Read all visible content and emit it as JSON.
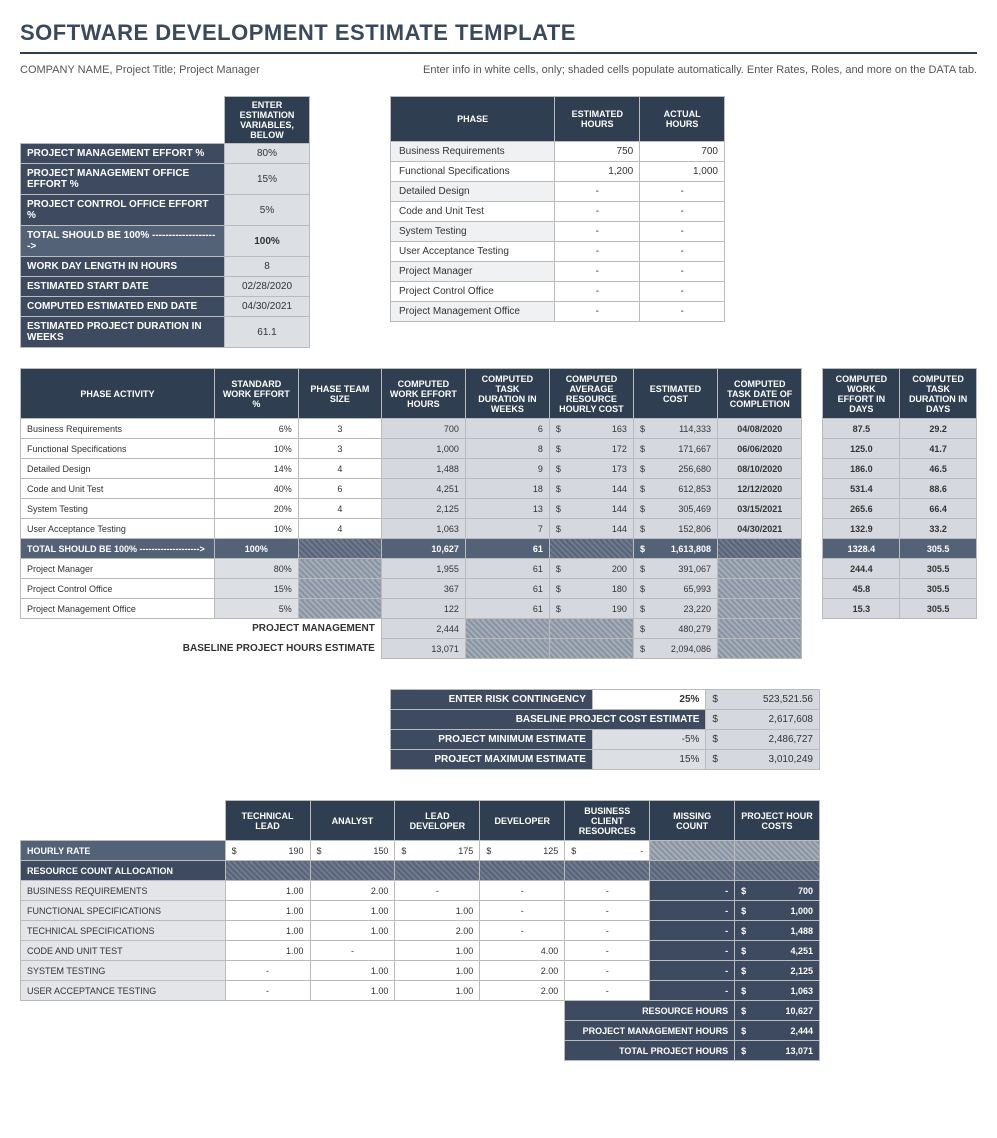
{
  "title": "SOFTWARE DEVELOPMENT ESTIMATE TEMPLATE",
  "company_line": "COMPANY NAME, Project Title; Project Manager",
  "instruction": "Enter info in white cells, only; shaded cells populate automatically.  Enter Rates, Roles, and more on the DATA tab.",
  "vars": {
    "header": "ENTER ESTIMATION VARIABLES, BELOW",
    "rows": [
      {
        "label": "PROJECT MANAGEMENT EFFORT %",
        "val": "80%"
      },
      {
        "label": "PROJECT MANAGEMENT OFFICE EFFORT %",
        "val": "15%"
      },
      {
        "label": "PROJECT CONTROL OFFICE EFFORT %",
        "val": "5%"
      }
    ],
    "total_label": "TOTAL SHOULD BE 100% -------------------->",
    "total_val": "100%",
    "rows2": [
      {
        "label": "WORK DAY LENGTH IN HOURS",
        "val": "8"
      },
      {
        "label": "ESTIMATED START DATE",
        "val": "02/28/2020"
      },
      {
        "label": "COMPUTED ESTIMATED END DATE",
        "val": "04/30/2021"
      },
      {
        "label": "ESTIMATED PROJECT DURATION IN WEEKS",
        "val": "61.1"
      }
    ]
  },
  "phases": {
    "h_phase": "PHASE",
    "h_est": "ESTIMATED HOURS",
    "h_act": "ACTUAL HOURS",
    "rows": [
      {
        "name": "Business Requirements",
        "est": "750",
        "act": "700"
      },
      {
        "name": "Functional Specifications",
        "est": "1,200",
        "act": "1,000"
      },
      {
        "name": "Detailed Design",
        "est": "-",
        "act": "-"
      },
      {
        "name": "Code and Unit Test",
        "est": "-",
        "act": "-"
      },
      {
        "name": "System Testing",
        "est": "-",
        "act": "-"
      },
      {
        "name": "User Acceptance Testing",
        "est": "-",
        "act": "-"
      },
      {
        "name": "Project Manager",
        "est": "-",
        "act": "-"
      },
      {
        "name": "Project Control Office",
        "est": "-",
        "act": "-"
      },
      {
        "name": "Project Management Office",
        "est": "-",
        "act": "-"
      }
    ]
  },
  "main": {
    "h": [
      "PHASE ACTIVITY",
      "STANDARD WORK EFFORT %",
      "PHASE TEAM SIZE",
      "COMPUTED WORK EFFORT HOURS",
      "COMPUTED TASK DURATION IN WEEKS",
      "COMPUTED AVERAGE RESOURCE HOURLY COST",
      "ESTIMATED COST",
      "COMPUTED TASK DATE OF COMPLETION"
    ],
    "rows": [
      {
        "a": "Business Requirements",
        "b": "6%",
        "c": "3",
        "d": "700",
        "e": "6",
        "f": "163",
        "g": "114,333",
        "h": "04/08/2020"
      },
      {
        "a": "Functional Specifications",
        "b": "10%",
        "c": "3",
        "d": "1,000",
        "e": "8",
        "f": "172",
        "g": "171,667",
        "h": "06/06/2020"
      },
      {
        "a": "Detailed Design",
        "b": "14%",
        "c": "4",
        "d": "1,488",
        "e": "9",
        "f": "173",
        "g": "256,680",
        "h": "08/10/2020"
      },
      {
        "a": "Code and Unit Test",
        "b": "40%",
        "c": "6",
        "d": "4,251",
        "e": "18",
        "f": "144",
        "g": "612,853",
        "h": "12/12/2020"
      },
      {
        "a": "System Testing",
        "b": "20%",
        "c": "4",
        "d": "2,125",
        "e": "13",
        "f": "144",
        "g": "305,469",
        "h": "03/15/2021"
      },
      {
        "a": "User Acceptance Testing",
        "b": "10%",
        "c": "4",
        "d": "1,063",
        "e": "7",
        "f": "144",
        "g": "152,806",
        "h": "04/30/2021"
      }
    ],
    "tot_label": "TOTAL SHOULD BE 100% -------------------->",
    "tot_pct": "100%",
    "tot_hrs": "10,627",
    "tot_wk": "61",
    "tot_cost": "1,613,808",
    "mgmt": [
      {
        "a": "Project Manager",
        "b": "80%",
        "d": "1,955",
        "e": "61",
        "f": "200",
        "g": "391,067"
      },
      {
        "a": "Project Control Office",
        "b": "15%",
        "d": "367",
        "e": "61",
        "f": "180",
        "g": "65,993"
      },
      {
        "a": "Project Management Office",
        "b": "5%",
        "d": "122",
        "e": "61",
        "f": "190",
        "g": "23,220"
      }
    ],
    "pm_label": "PROJECT MANAGEMENT",
    "pm_hrs": "2,444",
    "pm_cost": "480,279",
    "bl_label": "BASELINE PROJECT HOURS ESTIMATE",
    "bl_hrs": "13,071",
    "bl_cost": "2,094,086"
  },
  "side": {
    "h1": "COMPUTED WORK EFFORT IN DAYS",
    "h2": "COMPUTED TASK DURATION IN DAYS",
    "rows": [
      {
        "a": "87.5",
        "b": "29.2"
      },
      {
        "a": "125.0",
        "b": "41.7"
      },
      {
        "a": "186.0",
        "b": "46.5"
      },
      {
        "a": "531.4",
        "b": "88.6"
      },
      {
        "a": "265.6",
        "b": "66.4"
      },
      {
        "a": "132.9",
        "b": "33.2"
      }
    ],
    "tot": {
      "a": "1328.4",
      "b": "305.5"
    },
    "mgmt": [
      {
        "a": "244.4",
        "b": "305.5"
      },
      {
        "a": "45.8",
        "b": "305.5"
      },
      {
        "a": "15.3",
        "b": "305.5"
      }
    ]
  },
  "cont": {
    "risk_label": "ENTER RISK CONTINGENCY",
    "risk_pct": "25%",
    "risk_val": "523,521.56",
    "base_label": "BASELINE PROJECT COST ESTIMATE",
    "base_val": "2,617,608",
    "min_label": "PROJECT MINIMUM ESTIMATE",
    "min_pct": "-5%",
    "min_val": "2,486,727",
    "max_label": "PROJECT MAXIMUM ESTIMATE",
    "max_pct": "15%",
    "max_val": "3,010,249"
  },
  "roles": {
    "h": [
      "",
      "TECHNICAL LEAD",
      "ANALYST",
      "LEAD DEVELOPER",
      "DEVELOPER",
      "BUSINESS CLIENT RESOURCES",
      "MISSING COUNT",
      "PROJECT HOUR COSTS"
    ],
    "rate_label": "HOURLY RATE",
    "rate": [
      "190",
      "150",
      "175",
      "125",
      "-",
      "",
      ""
    ],
    "alloc_label": "RESOURCE COUNT ALLOCATION",
    "rows": [
      {
        "n": "BUSINESS REQUIREMENTS",
        "v": [
          "1.00",
          "2.00",
          "-",
          "-",
          "-",
          "-",
          "700"
        ]
      },
      {
        "n": "FUNCTIONAL SPECIFICATIONS",
        "v": [
          "1.00",
          "1.00",
          "1.00",
          "-",
          "-",
          "-",
          "1,000"
        ]
      },
      {
        "n": "TECHNICAL SPECIFICATIONS",
        "v": [
          "1.00",
          "1.00",
          "2.00",
          "-",
          "-",
          "-",
          "1,488"
        ]
      },
      {
        "n": "CODE AND UNIT TEST",
        "v": [
          "1.00",
          "-",
          "1.00",
          "4.00",
          "-",
          "-",
          "4,251"
        ]
      },
      {
        "n": "SYSTEM TESTING",
        "v": [
          "-",
          "1.00",
          "1.00",
          "2.00",
          "-",
          "-",
          "2,125"
        ]
      },
      {
        "n": "USER ACCEPTANCE TESTING",
        "v": [
          "-",
          "1.00",
          "1.00",
          "2.00",
          "-",
          "-",
          "1,063"
        ]
      }
    ],
    "sum": [
      {
        "l": "RESOURCE HOURS",
        "v": "10,627"
      },
      {
        "l": "PROJECT MANAGEMENT HOURS",
        "v": "2,444"
      },
      {
        "l": "TOTAL PROJECT HOURS",
        "v": "13,071"
      }
    ]
  },
  "cur": "$"
}
